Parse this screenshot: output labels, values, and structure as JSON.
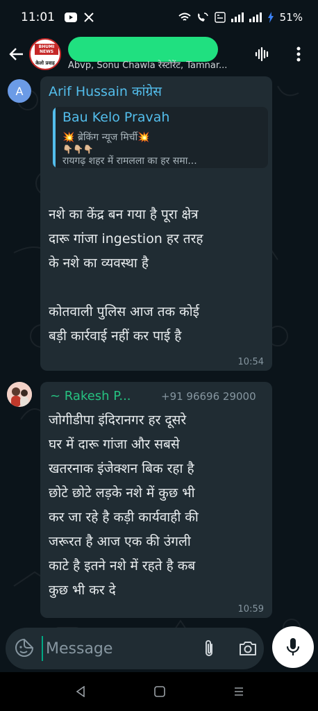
{
  "status_bar": {
    "time": "11:01",
    "battery": "51%",
    "icons": [
      "youtube-icon",
      "x-icon",
      "wifi-icon",
      "wifi-calling-icon",
      "volte-icon",
      "signal-icon",
      "signal-icon",
      "charging-icon"
    ]
  },
  "header": {
    "group_avatar_top": "BHUMI NEWS",
    "group_avatar_bottom": "केलो प्रवाह",
    "title_redacted": true,
    "subtitle": "Abvp, Sonu Chawla रेस्टोरेंट, Tamnar...",
    "icons": [
      "back-arrow-icon",
      "voice-chat-icon",
      "more-vert-icon"
    ]
  },
  "messages": [
    {
      "avatar_letter": "A",
      "avatar_color": "#6b9be6",
      "sender": "Arif Hussain कांग्रेस",
      "quote": {
        "name": "Bau Kelo Pravah",
        "line2": "💥 ब्रेकिंग न्यूज मिर्ची💥",
        "line3": "👇🏼👇🏼👇🏼",
        "line4": "रायगढ़ शहर में रामलला का हर समा..."
      },
      "body": "नशे का केंद्र बन गया है पूरा क्षेत्र\nदारू गांजा ingestion हर तरह\nके नशे का व्यवस्था है\n\nकोतवाली पुलिस आज तक कोई\nबड़ी कार्रवाई नहीं कर पाई है",
      "time": "10:54"
    },
    {
      "sender": "~ Rakesh P...",
      "phone": "+91 96696 29000",
      "body": "जोगीडीपा इंदिरानगर हर दूसरे\nघर में दारू गांजा और सबसे\nखतरनाक इंजेक्शन बिक रहा है\nछोटे छोटे लड़के नशे में कुछ भी\nकर जा रहे है कड़ी कार्यवाही की\nजरूरत है आज एक की उंगली\nकाटे है इतने नशे में रहते है कब\nकुछ भी कर दे",
      "time": "10:59"
    }
  ],
  "input": {
    "placeholder": "Message",
    "value": ""
  },
  "colors": {
    "background": "#0b141a",
    "bubble": "#202c33",
    "quote_bg": "#1a2329",
    "accent_blue": "#53bdeb",
    "accent_green": "#26c281",
    "redaction": "#20e080"
  }
}
